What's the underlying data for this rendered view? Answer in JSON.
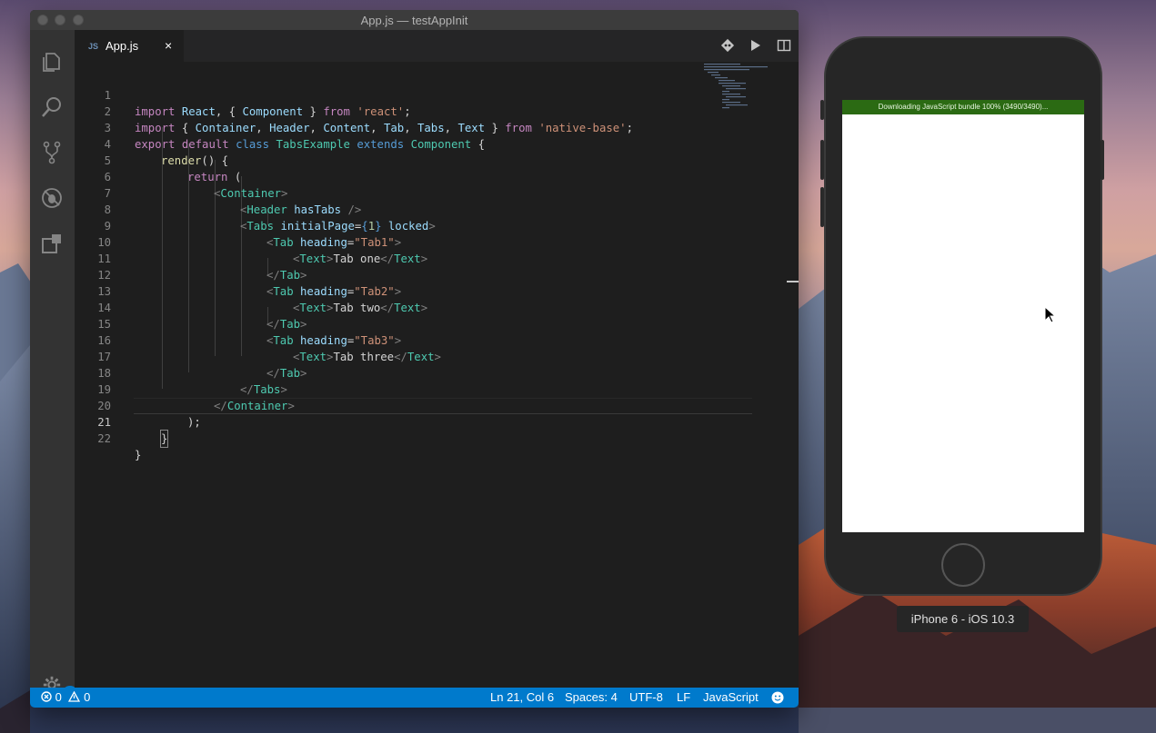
{
  "window": {
    "title": "App.js — testAppInit"
  },
  "activity_bar": {
    "icons": [
      "files-icon",
      "search-icon",
      "source-control-icon",
      "debug-icon",
      "extensions-icon"
    ],
    "settings_badge": "1"
  },
  "tabs": [
    {
      "lang": "JS",
      "label": "App.js",
      "close": "×"
    }
  ],
  "editor": {
    "lines": [
      {
        "n": "1"
      },
      {
        "n": "2"
      },
      {
        "n": "3"
      },
      {
        "n": "4"
      },
      {
        "n": "5"
      },
      {
        "n": "6"
      },
      {
        "n": "7"
      },
      {
        "n": "8"
      },
      {
        "n": "9"
      },
      {
        "n": "10"
      },
      {
        "n": "11"
      },
      {
        "n": "12"
      },
      {
        "n": "13"
      },
      {
        "n": "14"
      },
      {
        "n": "15"
      },
      {
        "n": "16"
      },
      {
        "n": "17"
      },
      {
        "n": "18"
      },
      {
        "n": "19"
      },
      {
        "n": "20"
      },
      {
        "n": "21"
      },
      {
        "n": "22"
      }
    ],
    "code": {
      "l1": [
        "import",
        " ",
        "React",
        ", { ",
        "Component",
        " } ",
        "from",
        " ",
        "'react'",
        ";"
      ],
      "l2": [
        "import",
        " { ",
        "Container",
        ", ",
        "Header",
        ", ",
        "Content",
        ", ",
        "Tab",
        ", ",
        "Tabs",
        ", ",
        "Text",
        " } ",
        "from",
        " ",
        "'native-base'",
        ";"
      ],
      "l3": [
        "export",
        " ",
        "default",
        " ",
        "class",
        " ",
        "TabsExample",
        " ",
        "extends",
        " ",
        "Component",
        " {"
      ],
      "l4": [
        "render",
        "() {"
      ],
      "l5": [
        "return",
        " ("
      ],
      "l6": [
        "<",
        "Container",
        ">"
      ],
      "l7": [
        "<",
        "Header",
        " ",
        "hasTabs",
        " />"
      ],
      "l8": [
        "<",
        "Tabs",
        " ",
        "initialPage",
        "=",
        "{",
        "1",
        "}",
        " ",
        "locked",
        ">"
      ],
      "l9": [
        "<",
        "Tab",
        " ",
        "heading",
        "=",
        "\"Tab1\"",
        ">"
      ],
      "l10": [
        "<",
        "Text",
        ">",
        "Tab one",
        "</",
        "Text",
        ">"
      ],
      "l11": [
        "</",
        "Tab",
        ">"
      ],
      "l12": [
        "<",
        "Tab",
        " ",
        "heading",
        "=",
        "\"Tab2\"",
        ">"
      ],
      "l13": [
        "<",
        "Text",
        ">",
        "Tab two",
        "</",
        "Text",
        ">"
      ],
      "l14": [
        "</",
        "Tab",
        ">"
      ],
      "l15": [
        "<",
        "Tab",
        " ",
        "heading",
        "=",
        "\"Tab3\"",
        ">"
      ],
      "l16": [
        "<",
        "Text",
        ">",
        "Tab three",
        "</",
        "Text",
        ">"
      ],
      "l17": [
        "</",
        "Tab",
        ">"
      ],
      "l18": [
        "</",
        "Tabs",
        ">"
      ],
      "l19": [
        "</",
        "Container",
        ">"
      ],
      "l20": [
        ");"
      ],
      "l21": [
        "}"
      ],
      "l22": [
        "}"
      ]
    }
  },
  "statusbar": {
    "errors": "0",
    "warnings": "0",
    "position": "Ln 21, Col 6",
    "spaces": "Spaces: 4",
    "encoding": "UTF-8",
    "eol": "LF",
    "language": "JavaScript"
  },
  "simulator": {
    "banner": "Downloading JavaScript bundle 100% (3490/3490)...",
    "device_label": "iPhone 6 - iOS 10.3"
  },
  "colors": {
    "accent": "#007acc",
    "banner": "#2b6a13",
    "editor_bg": "#1e1e1e"
  }
}
